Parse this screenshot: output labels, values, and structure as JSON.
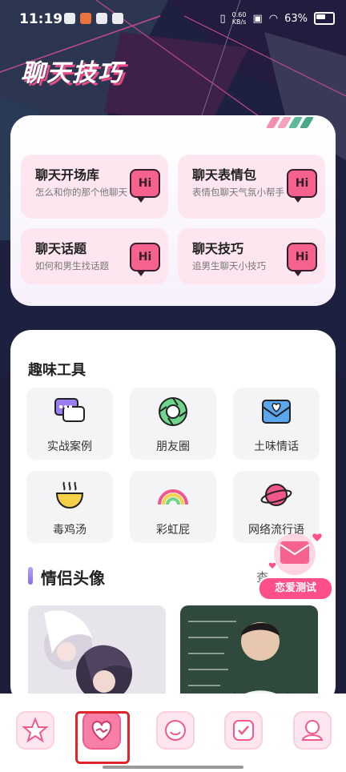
{
  "status": {
    "time": "11:19",
    "speed_value": "0.60",
    "speed_unit": "KB/s",
    "battery": "63%"
  },
  "header": {
    "title": "聊天技巧"
  },
  "features": [
    {
      "title": "聊天开场库",
      "subtitle": "怎么和你的那个他聊天",
      "badge": "Hi"
    },
    {
      "title": "聊天表情包",
      "subtitle": "表情包聊天气氛小帮手",
      "badge": "Hi"
    },
    {
      "title": "聊天话题",
      "subtitle": "如何和男生找话题",
      "badge": "Hi"
    },
    {
      "title": "聊天技巧",
      "subtitle": "追男生聊天小技巧",
      "badge": "Hi"
    }
  ],
  "tools_section": {
    "title": "趣味工具"
  },
  "tools": [
    {
      "label": "实战案例",
      "icon": "chat-bubbles-icon"
    },
    {
      "label": "朋友圈",
      "icon": "camera-shutter-icon"
    },
    {
      "label": "土味情话",
      "icon": "heart-envelope-icon"
    },
    {
      "label": "毒鸡汤",
      "icon": "soup-bowl-icon"
    },
    {
      "label": "彩虹屁",
      "icon": "rainbow-icon"
    },
    {
      "label": "网络流行语",
      "icon": "planet-icon"
    }
  ],
  "couple_section": {
    "title": "情侣头像",
    "more": "查"
  },
  "floating": {
    "label": "恋爱测试"
  },
  "nav": {
    "items": [
      {
        "icon": "star-icon"
      },
      {
        "icon": "heart-chat-icon",
        "active": true
      },
      {
        "icon": "q-chat-icon"
      },
      {
        "icon": "check-heart-icon"
      },
      {
        "icon": "profile-icon"
      }
    ]
  },
  "colors": {
    "accent": "#f5628d",
    "card_pink": "#fde6ef",
    "bg_dark": "#1d1f3a"
  }
}
